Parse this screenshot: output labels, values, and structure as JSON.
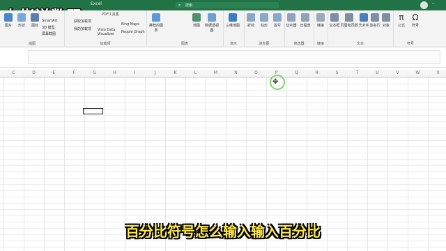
{
  "window": {
    "app_name": "Excel",
    "search_placeholder": "搜索"
  },
  "watermark": {
    "text": "大佬说数码"
  },
  "ribbon": {
    "groups": [
      {
        "label": "插图"
      },
      {
        "label": "加载项"
      },
      {
        "label": "图表"
      },
      {
        "label": "演示"
      },
      {
        "label": "迷你图"
      },
      {
        "label": "筛选器"
      },
      {
        "label": "链接"
      },
      {
        "label": "文本"
      },
      {
        "label": "符号"
      }
    ],
    "buttons": {
      "pictures": "图片",
      "shapes": "形状",
      "icons": "图标",
      "smartart": "SmartArt",
      "model3d": "3D 模型",
      "screenshot": "屏幕截图",
      "get_addins": "获取加载项",
      "my_addins": "我的加载项",
      "visio": "Visio Data Visualizer",
      "bing_maps": "Bing Maps",
      "people_graph": "People Graph",
      "recommended_charts": "推荐的图表",
      "maps": "地图",
      "pivotchart": "数据透视图",
      "map3d": "三维地图",
      "line": "折线",
      "column": "柱形",
      "winloss": "盈亏",
      "slicer": "切片器",
      "timeline": "日程表",
      "link": "链接",
      "textbox": "文本框",
      "header_footer": "页眉和页脚",
      "wordart": "艺术字",
      "signature": "签名行",
      "object": "对象",
      "equation": "公式",
      "symbol": "符号",
      "pdf_tools": "PDF工具集"
    }
  },
  "columns": [
    "C",
    "D",
    "E",
    "F",
    "G",
    "H",
    "I",
    "J",
    "K",
    "L",
    "M",
    "N",
    "O",
    "P",
    "Q",
    "R",
    "S",
    "T",
    "U",
    "V",
    "W",
    "X"
  ],
  "subtitle": {
    "text": "百分比符号怎么输入输入百分比"
  }
}
